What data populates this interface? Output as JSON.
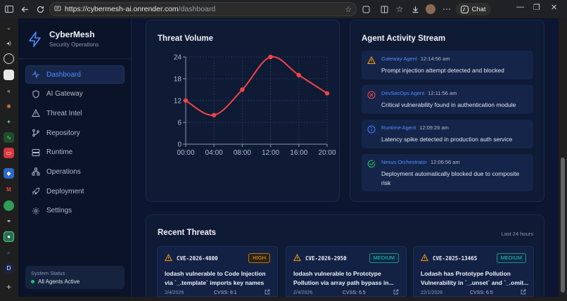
{
  "browser": {
    "url_host": "https://cybermesh-ai.onrender.com",
    "url_path": "/dashboard",
    "chat_label": "Chat"
  },
  "app": {
    "brand": {
      "title": "CyberMesh",
      "subtitle": "Security Operations"
    },
    "nav": [
      {
        "label": "Dashboard",
        "icon": "activity-icon",
        "active": true
      },
      {
        "label": "AI Gateway",
        "icon": "shield-icon"
      },
      {
        "label": "Threat Intel",
        "icon": "alert-triangle-icon"
      },
      {
        "label": "Repository",
        "icon": "git-branch-icon"
      },
      {
        "label": "Runtime",
        "icon": "server-icon"
      },
      {
        "label": "Operations",
        "icon": "network-icon"
      },
      {
        "label": "Deployment",
        "icon": "rocket-icon"
      },
      {
        "label": "Settings",
        "icon": "gear-icon"
      }
    ],
    "system_status": {
      "label": "System Status",
      "value": "All Agents Active"
    },
    "threat_volume": {
      "title": "Threat Volume"
    },
    "agent_stream": {
      "title": "Agent Activity Stream",
      "items": [
        {
          "agent": "Gateway Agent",
          "time": "12:14:56 am",
          "message": "Prompt injection attempt detected and blocked",
          "type": "warning",
          "color": "#f59e0b"
        },
        {
          "agent": "DevSecOps Agent",
          "time": "12:11:56 am",
          "message": "Critical vulnerability found in authentication module",
          "type": "error",
          "color": "#ef4444"
        },
        {
          "agent": "Runtime Agent",
          "time": "12:09:26 am",
          "message": "Latency spike detected in production auth service",
          "type": "info",
          "color": "#3b82f6"
        },
        {
          "agent": "Nexus Orchestrator",
          "time": "12:06:56 am",
          "message": "Deployment automatically blocked due to composite risk",
          "type": "success",
          "color": "#22c55e"
        }
      ]
    },
    "recent_threats": {
      "title": "Recent Threats",
      "range": "Last 24 hours",
      "cards": [
        {
          "cve": "CVE-2026-4800",
          "severity": "HIGH",
          "title": "lodash vulnerable to Code Injection via `_.template` imports key names",
          "date": "2/4/2026",
          "cvss": "CVSS: 8.1"
        },
        {
          "cve": "CVE-2026-2950",
          "severity": "MEDIUM",
          "title": "lodash vulnerable to Prototype Pollution via array path bypass in...",
          "date": "2/4/2026",
          "cvss": "CVSS: 6.5"
        },
        {
          "cve": "CVE-2025-13465",
          "severity": "MEDIUM",
          "title": "Lodash has Prototype Pollution Vulnerability in `_.unset` and `_.omit...",
          "date": "22/1/2026",
          "cvss": "CVSS: 6.5"
        }
      ]
    }
  },
  "chart_data": {
    "type": "line",
    "title": "Threat Volume",
    "x": [
      "00:00",
      "04:00",
      "08:00",
      "12:00",
      "16:00",
      "20:00"
    ],
    "series": [
      {
        "values": [
          12,
          8,
          15,
          24,
          19,
          14
        ],
        "color": "#ef4444"
      }
    ],
    "yticks": [
      0,
      6,
      12,
      18,
      24
    ],
    "ylim": [
      0,
      24
    ],
    "grid": true,
    "legend": "none"
  }
}
